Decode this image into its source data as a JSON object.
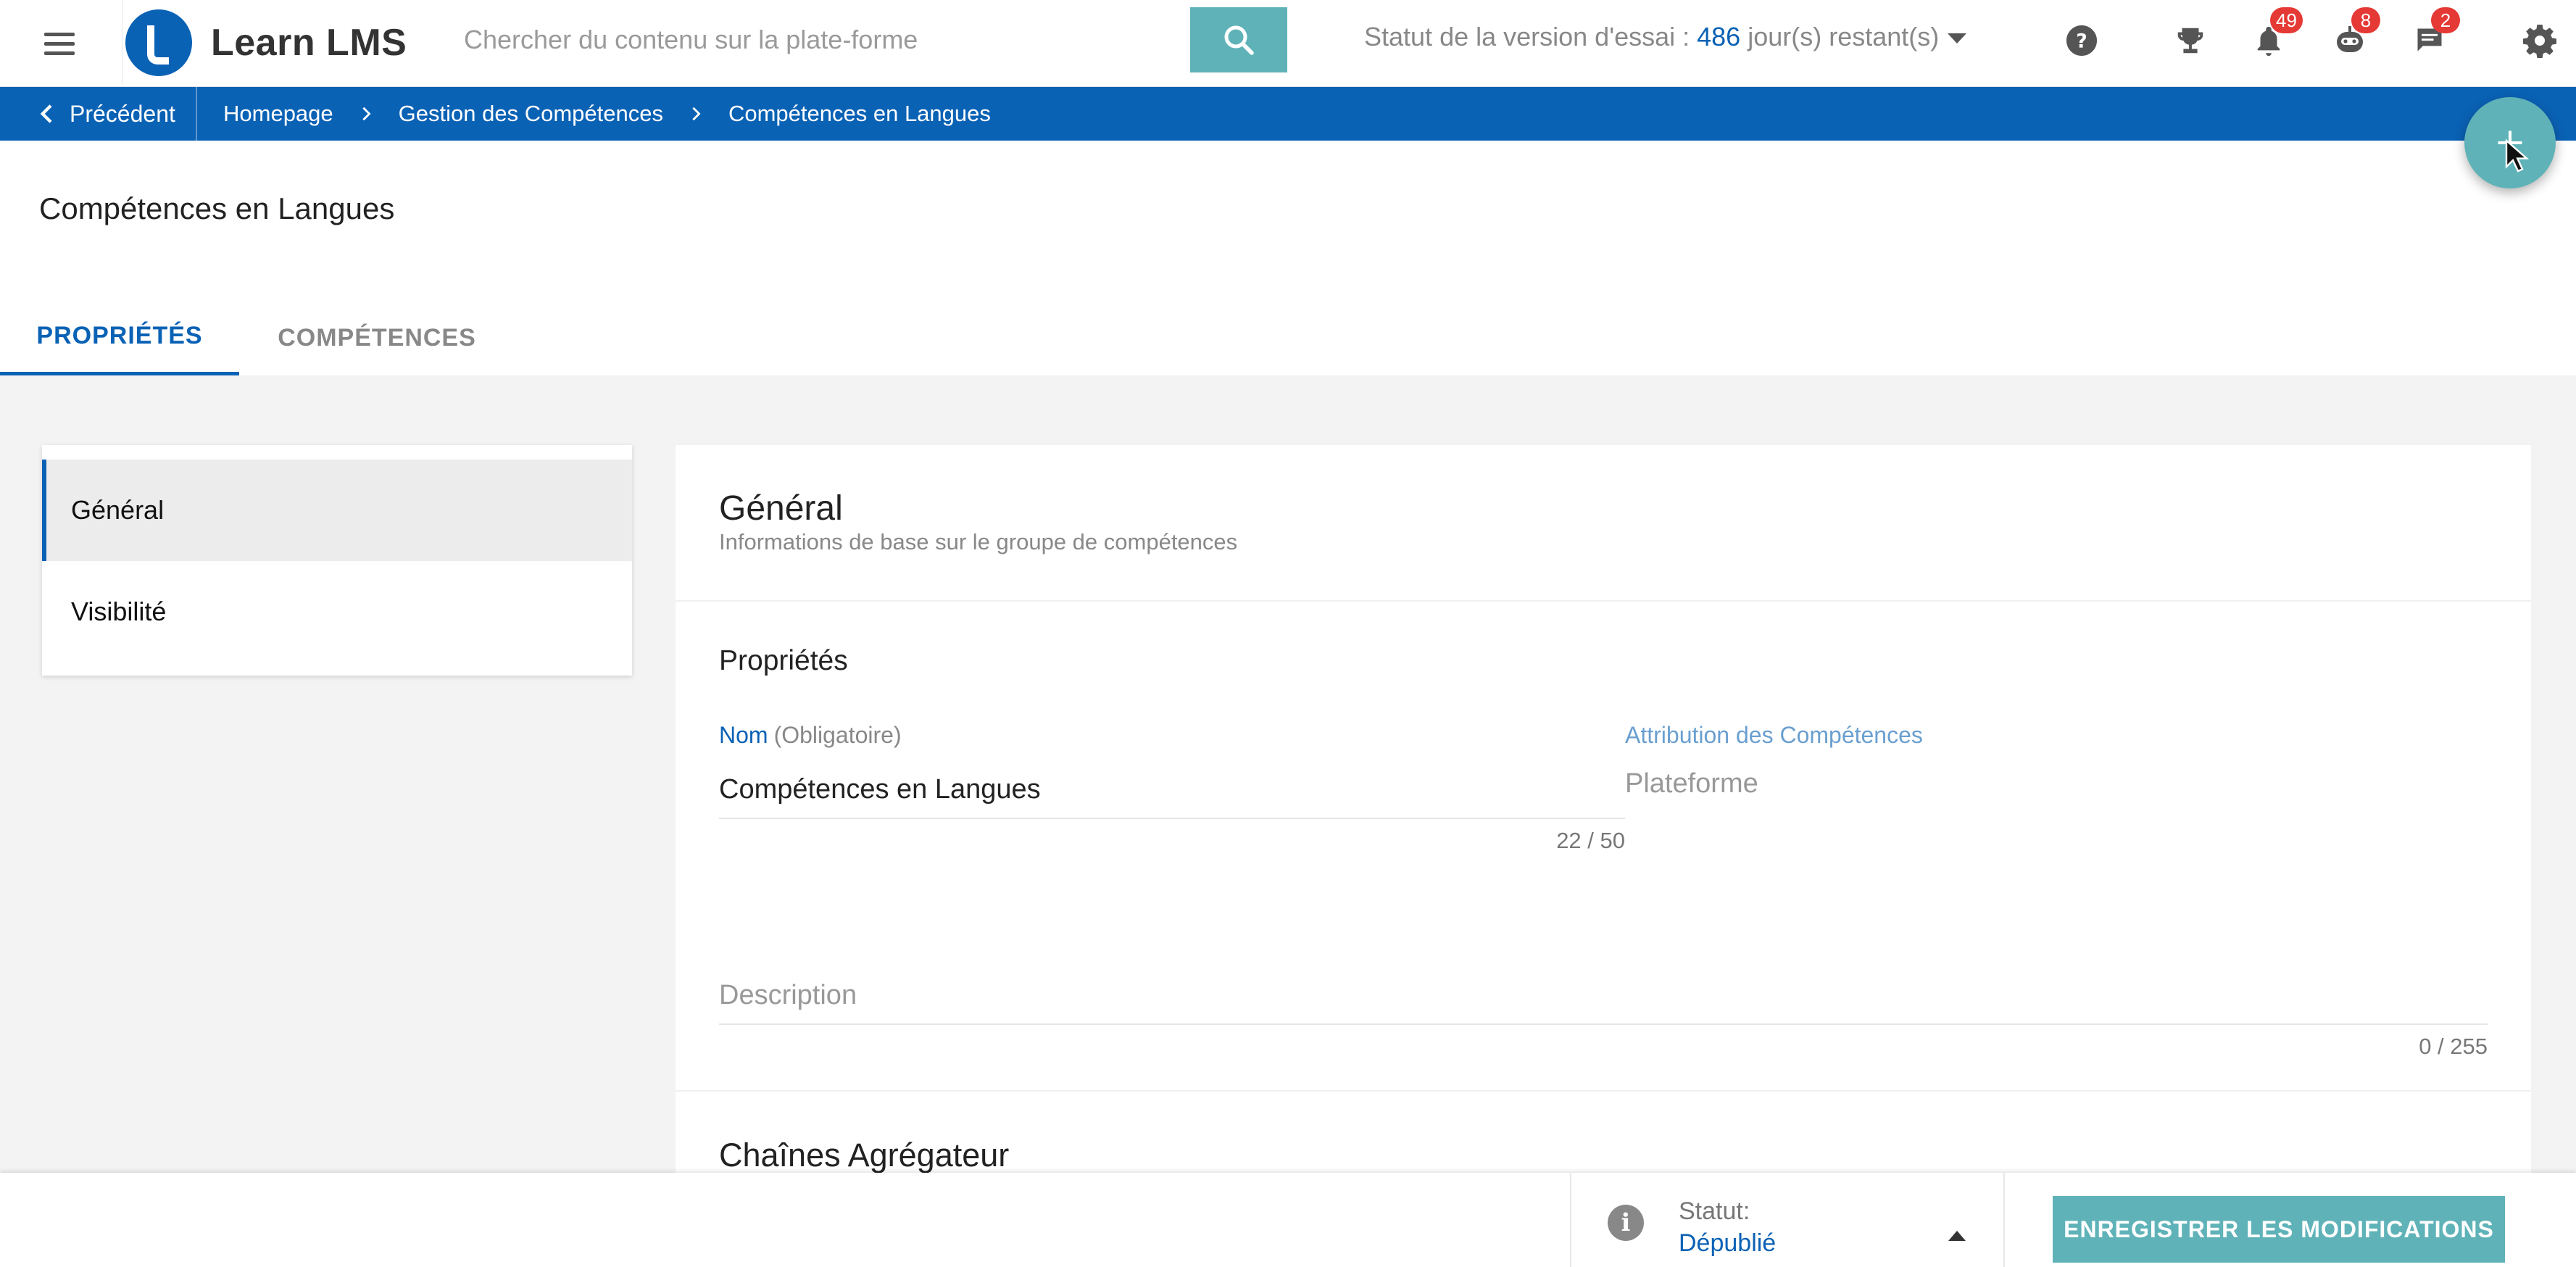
{
  "header": {
    "app_name": "Learn LMS",
    "search_placeholder": "Chercher du contenu sur la plate-forme",
    "trial_prefix": "Statut de la version d'essai : ",
    "trial_days": "486",
    "trial_suffix": " jour(s) restant(s)",
    "badges": {
      "notifications": "49",
      "bot": "8",
      "messages": "2"
    }
  },
  "breadcrumb": {
    "back_label": "Précédent",
    "items": [
      "Homepage",
      "Gestion des Compétences",
      "Compétences en Langues"
    ]
  },
  "page": {
    "title": "Compétences en Langues",
    "tabs": [
      {
        "label": "PROPRIÉTÉS",
        "active": true
      },
      {
        "label": "COMPÉTENCES",
        "active": false
      }
    ]
  },
  "sidebar": {
    "items": [
      {
        "label": "Général",
        "active": true
      },
      {
        "label": "Visibilité",
        "active": false
      }
    ]
  },
  "general": {
    "title": "Général",
    "subtitle": "Informations de base sur le groupe de compétences",
    "properties_title": "Propriétés",
    "name_label": "Nom",
    "name_required": "(Obligatoire)",
    "name_value": "Compétences en Langues",
    "name_counter": "22 / 50",
    "attribution_label": "Attribution des Compétences",
    "attribution_value": "Plateforme",
    "description_placeholder": "Description",
    "description_counter": "0 / 255",
    "aggregator_title": "Chaînes Agrégateur"
  },
  "footer": {
    "status_label": "Statut:",
    "status_value": "Dépublié",
    "save_label": "ENREGISTRER LES MODIFICATIONS"
  },
  "colors": {
    "brand_blue": "#0a62b5",
    "accent_teal": "#5fb3b8",
    "badge_red": "#e53935"
  },
  "icons": [
    "menu-icon",
    "search-icon",
    "help-icon",
    "trophy-icon",
    "bell-icon",
    "bot-icon",
    "chat-icon",
    "gear-icon",
    "chevron-left-icon",
    "chevron-right-icon",
    "plus-icon",
    "info-icon",
    "caret-up-icon",
    "caret-down-icon",
    "cursor-icon"
  ]
}
